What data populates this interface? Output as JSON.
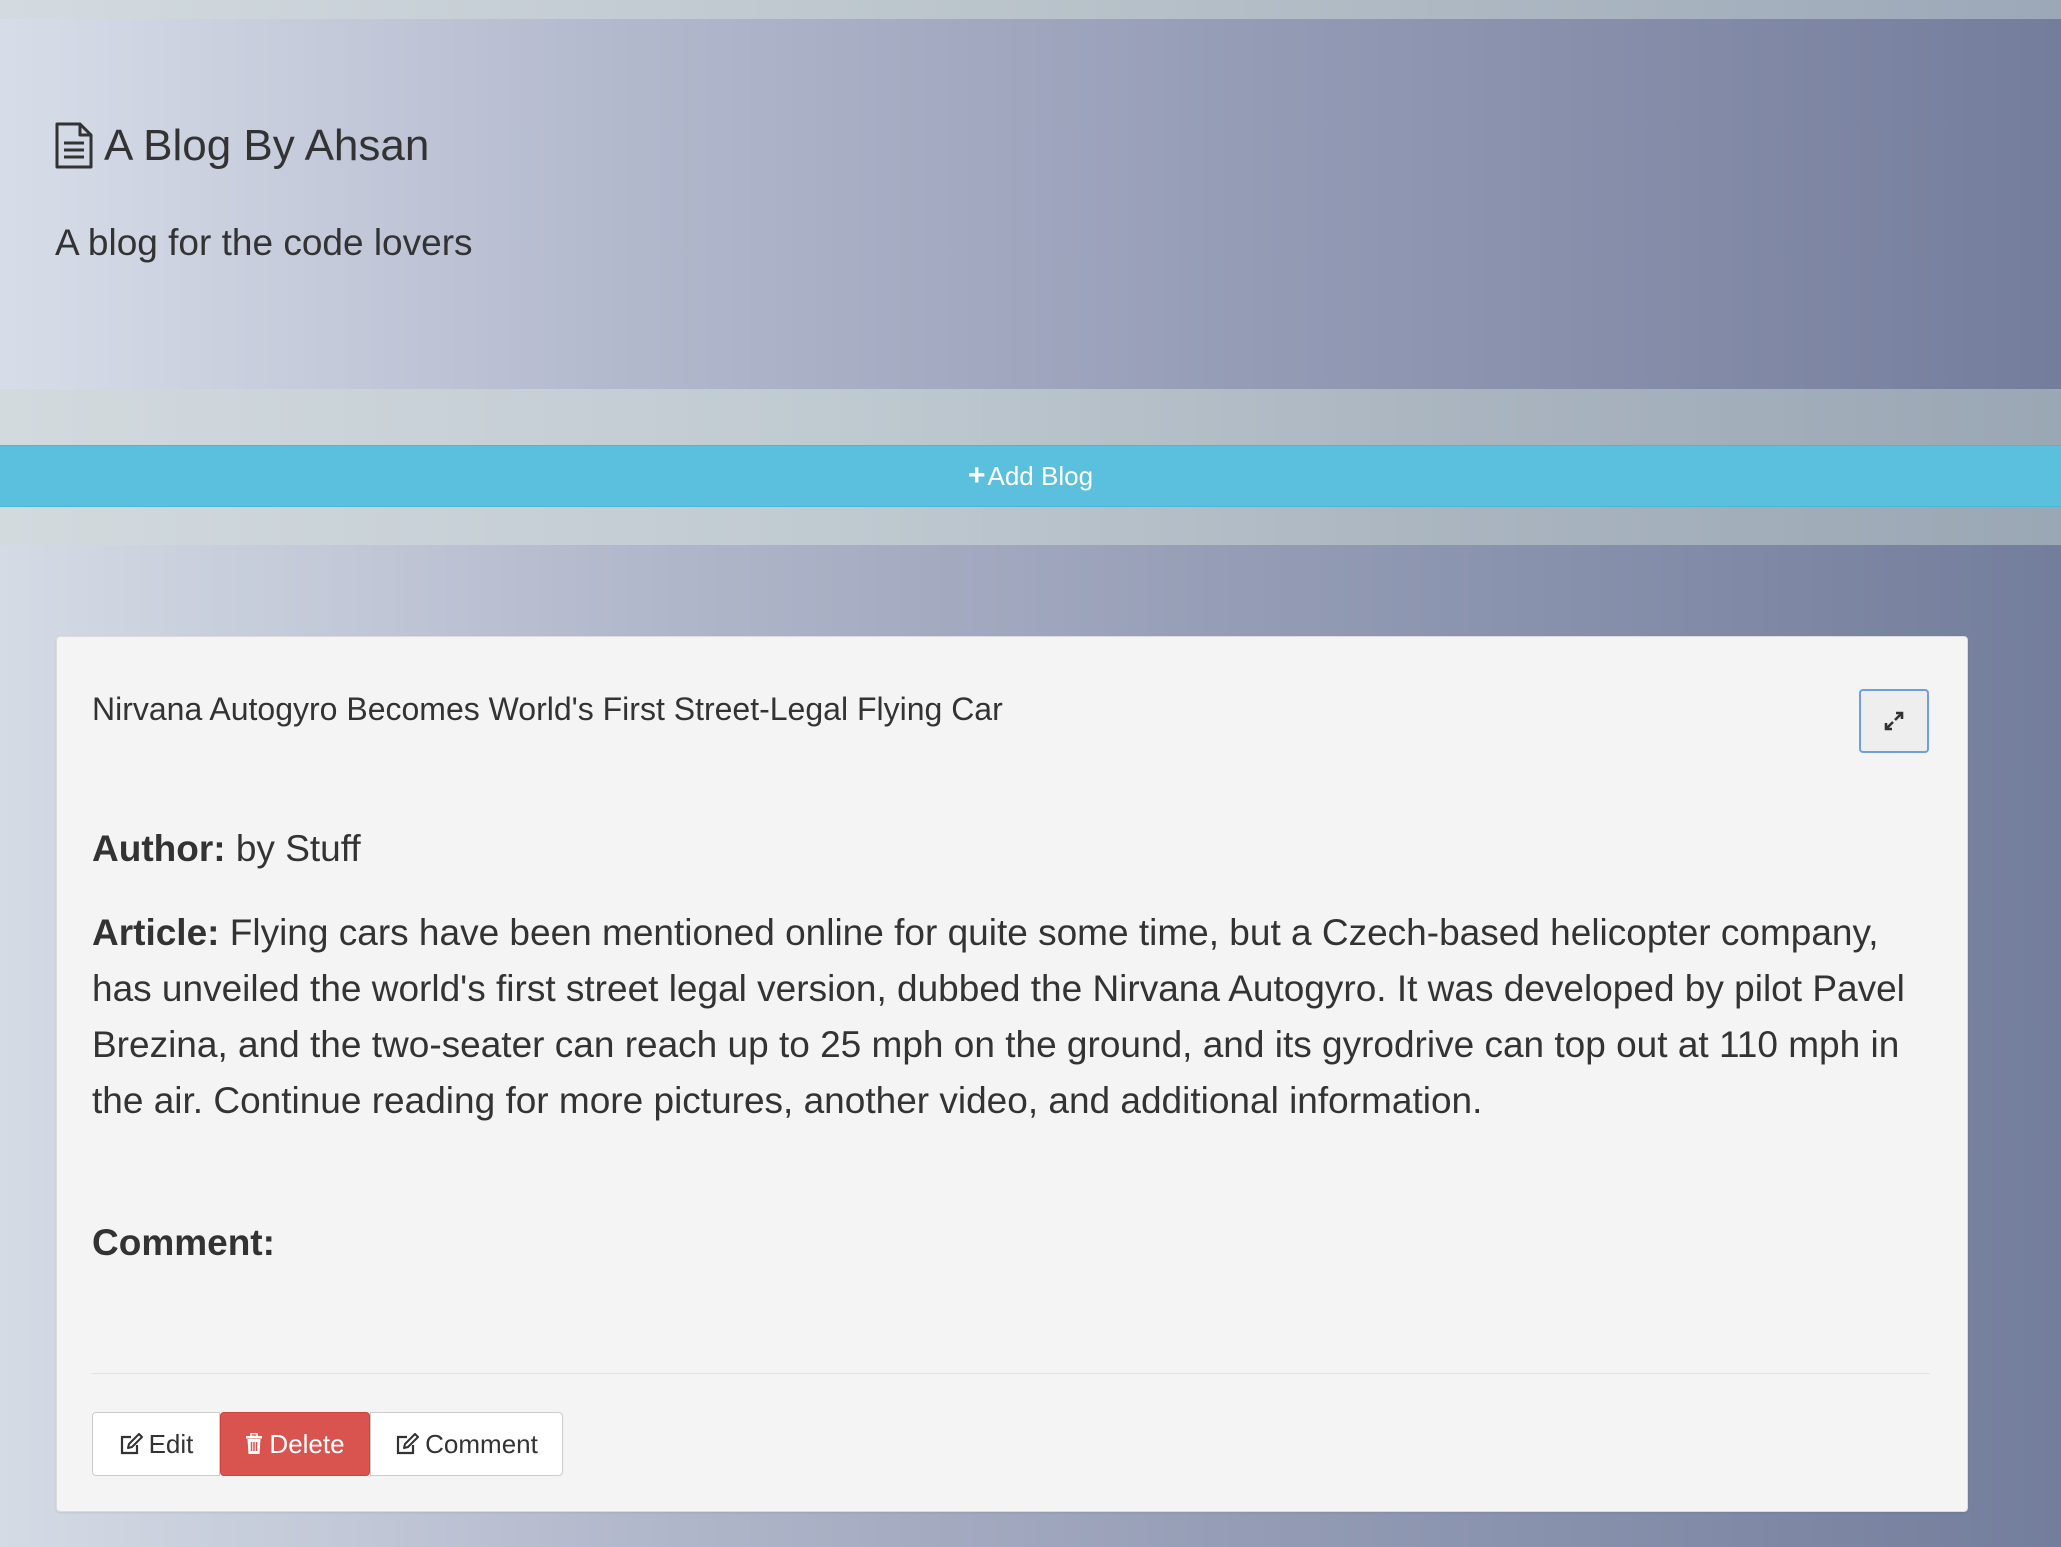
{
  "header": {
    "title": "A Blog By Ahsan",
    "subtitle": "A blog for the code lovers",
    "title_icon": "file-text-icon"
  },
  "add_blog": {
    "label": "Add Blog",
    "icon": "plus-icon",
    "color": "#5bc0de"
  },
  "post": {
    "title": "Nirvana Autogyro Becomes World's First Street-Legal Flying Car",
    "author_label": "Author:",
    "author": "by Stuff",
    "article_label": "Article:",
    "article": "Flying cars have been mentioned online for quite some time, but a Czech-based helicopter company, has unveiled the world's first street legal version, dubbed the Nirvana Autogyro. It was developed by pilot Pavel Brezina, and the two-seater can reach up to 25 mph on the ground, and its gyrodrive can top out at 110 mph in the air. Continue reading for more pictures, another video, and additional information.",
    "comment_label": "Comment:",
    "comment": "",
    "expand_icon": "expand-icon"
  },
  "actions": {
    "edit_label": "Edit",
    "delete_label": "Delete",
    "comment_label": "Comment",
    "delete_color": "#d9534f"
  }
}
